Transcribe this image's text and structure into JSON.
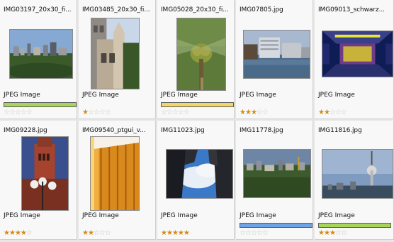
{
  "images": [
    {
      "name": "IMG03197_20x30_fi...",
      "type": "JPEG Image",
      "rating": 0,
      "label_color": "#a6d55a",
      "thumb": "skyline"
    },
    {
      "name": "IMG03485_20x30_fi...",
      "type": "JPEG Image",
      "rating": 1,
      "label_color": null,
      "thumb": "church-portrait"
    },
    {
      "name": "IMG05028_20x30_fi...",
      "type": "JPEG Image",
      "rating": 0,
      "label_color": "#f1d765",
      "thumb": "dragonfly"
    },
    {
      "name": "IMG07805.jpg",
      "type": "JPEG Image",
      "rating": 3,
      "label_color": null,
      "thumb": "office-water"
    },
    {
      "name": "IMG09013_schwarz...",
      "type": "JPEG Image",
      "rating": 2,
      "label_color": null,
      "thumb": "yellow-tunnel"
    },
    {
      "name": "IMG09228.jpg",
      "type": "JPEG Image",
      "rating": 4,
      "label_color": null,
      "thumb": "red-tower"
    },
    {
      "name": "IMG09540_ptgui_v...",
      "type": "JPEG Image",
      "rating": 2,
      "label_color": null,
      "thumb": "orange-facade"
    },
    {
      "name": "IMG11023.jpg",
      "type": "JPEG Image",
      "rating": 5,
      "label_color": null,
      "thumb": "sky-buildings"
    },
    {
      "name": "IMG11778.jpg",
      "type": "JPEG Image",
      "rating": 0,
      "label_color": "#6fa3e8",
      "thumb": "city-panorama"
    },
    {
      "name": "IMG11816.jpg",
      "type": "JPEG Image",
      "rating": 3,
      "label_color": "#a6d55a",
      "thumb": "tv-tower"
    }
  ],
  "max_rating": 5,
  "colors": {
    "star_on": "#d58a14",
    "star_off": "#c3c3c3",
    "cell_bg": "#f8f8f8"
  }
}
